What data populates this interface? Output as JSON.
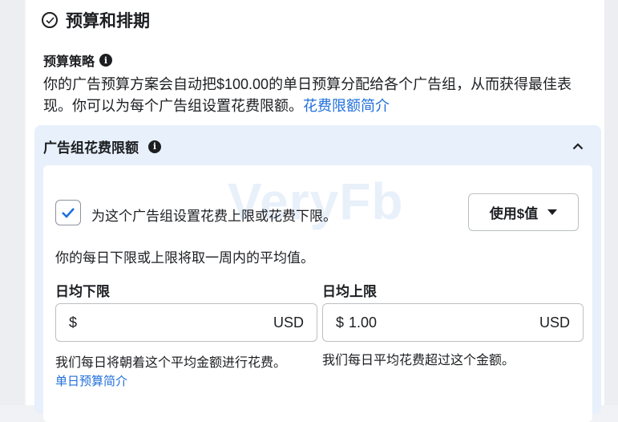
{
  "section": {
    "title": "预算和排期"
  },
  "budget_strategy": {
    "label": "预算策略",
    "description": "你的广告预算方案会自动把$100.00的单日预算分配给各个广告组，从而获得最佳表现。你可以为每个广告组设置花费限额。",
    "link": "花费限额简介"
  },
  "spend_cap": {
    "title": "广告组花费限额",
    "checkbox_label": "为这个广告组设置花费上限或花费下限。",
    "checkbox_checked": true,
    "dropdown_label": "使用$值",
    "note": "你的每日下限或上限将取一周内的平均值。",
    "min": {
      "label": "日均下限",
      "prefix": "$",
      "value": "",
      "currency": "USD",
      "helper": "我们每日将朝着这个平均金额进行花费。",
      "link": "单日预算简介"
    },
    "max": {
      "label": "日均上限",
      "prefix": "$",
      "value": "1.00",
      "currency": "USD",
      "helper": "我们每日平均花费超过这个金额。"
    }
  },
  "watermark": "VeryFb",
  "colors": {
    "accent": "#216fdb",
    "panel": "#e7f0fb"
  }
}
